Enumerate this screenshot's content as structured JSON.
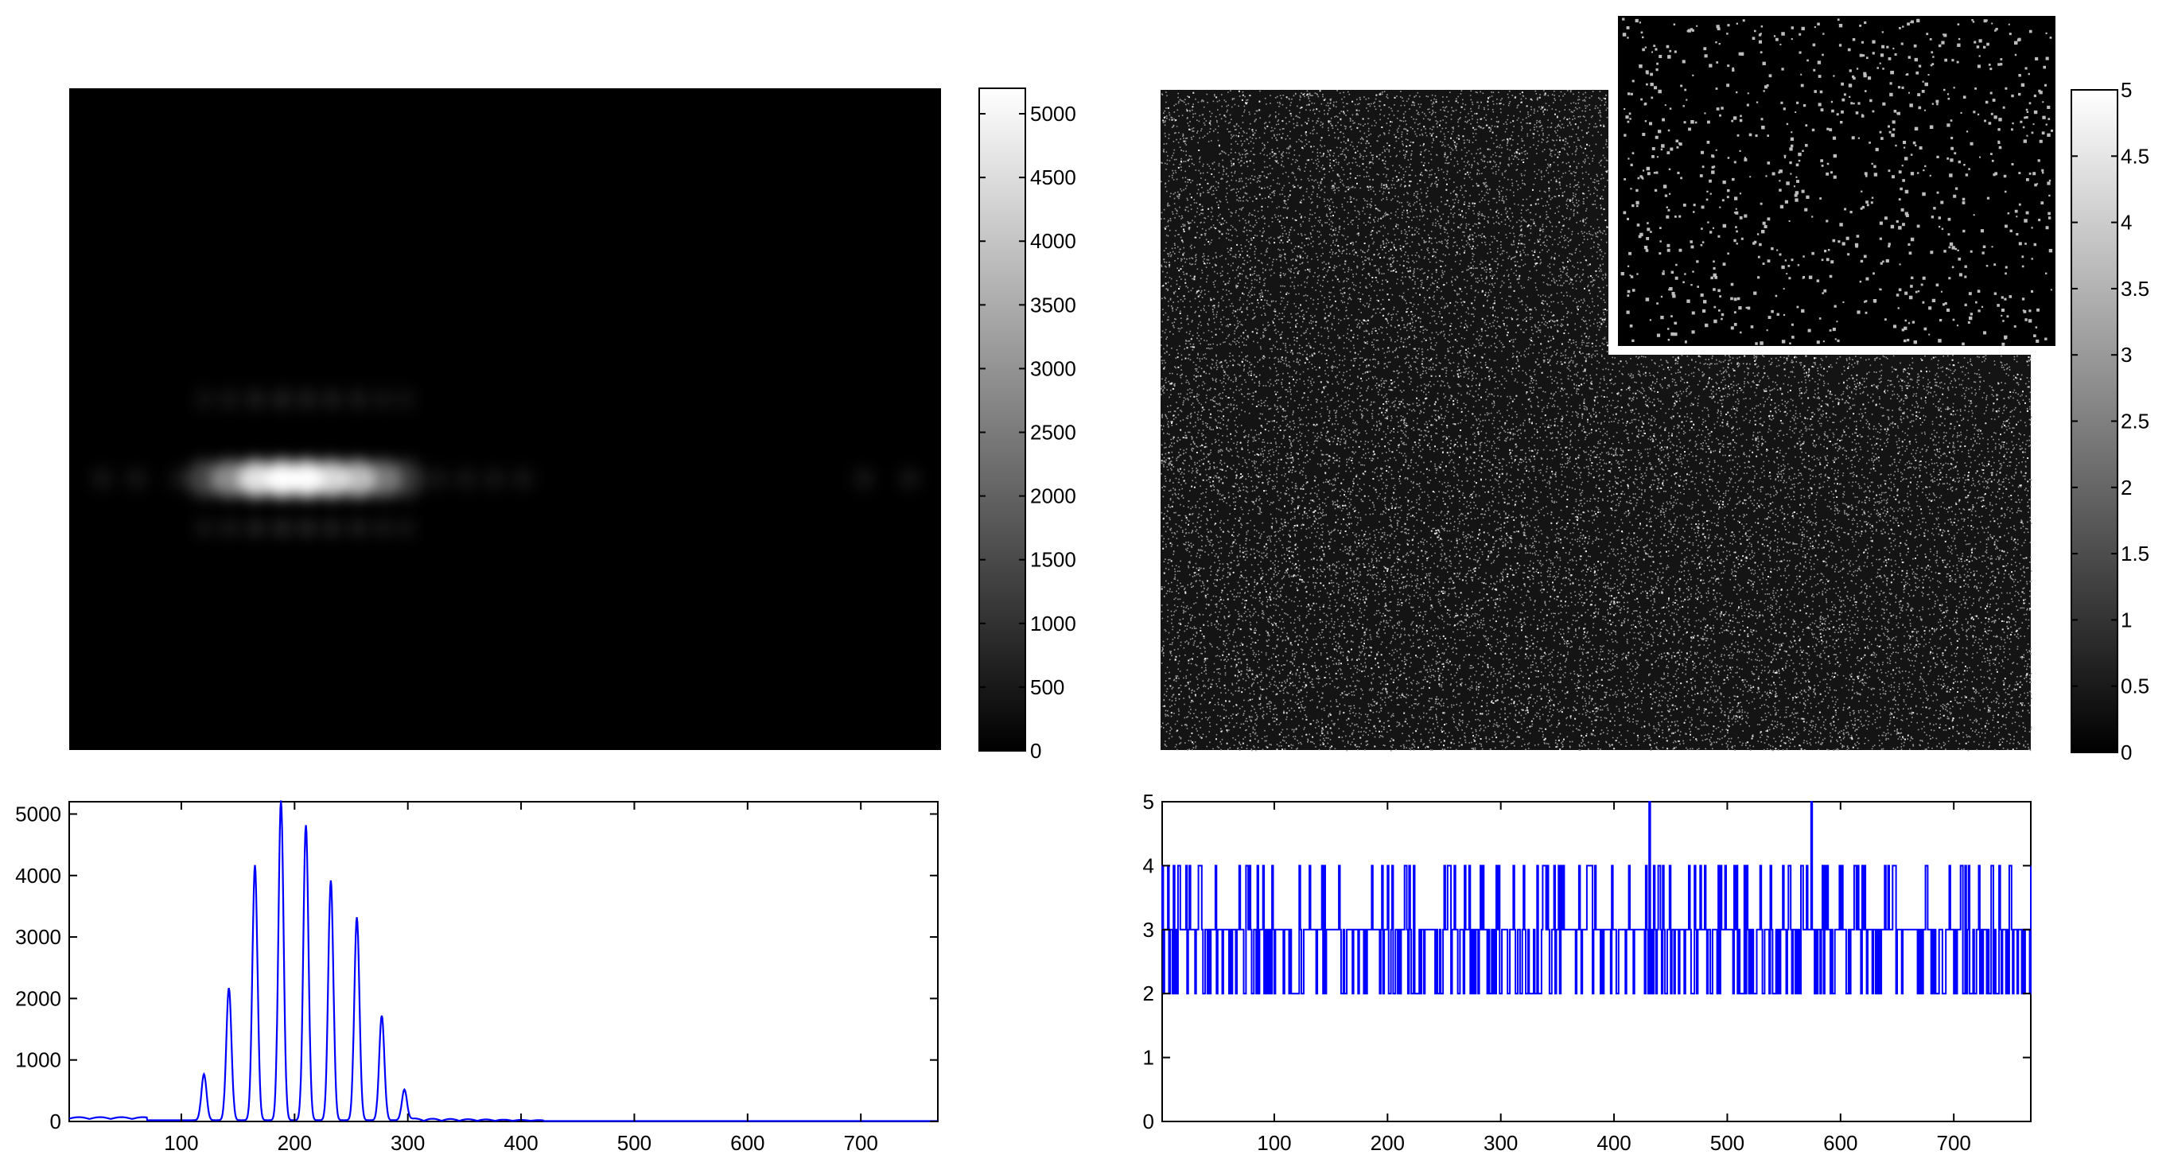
{
  "colors": {
    "line": "#0000ff",
    "image_background": "#000000",
    "axis": "#000000",
    "frame": "#ffffff"
  },
  "chart_data": [
    {
      "type": "heatmap",
      "colormap": "gray",
      "clim": [
        0,
        5200
      ],
      "colorbar_ticks": [
        "0",
        "500",
        "1000",
        "1500",
        "2000",
        "2500",
        "3000",
        "3500",
        "4000",
        "4500",
        "5000"
      ],
      "colorbar_tick_values": [
        0,
        500,
        1000,
        1500,
        2000,
        2500,
        3000,
        3500,
        4000,
        4500,
        5000
      ],
      "columns": 768,
      "spot_centers_x": [
        120,
        142,
        165,
        188,
        210,
        232,
        255,
        277,
        297
      ],
      "spot_peaks": [
        750,
        2150,
        4150,
        5200,
        4800,
        3900,
        3300,
        1700,
        500
      ],
      "center_row_fraction": 0.59
    },
    {
      "type": "line",
      "xlim": [
        1,
        768
      ],
      "ylim": [
        0,
        5200
      ],
      "xticks": [
        "100",
        "200",
        "300",
        "400",
        "500",
        "600",
        "700"
      ],
      "xtick_values": [
        100,
        200,
        300,
        400,
        500,
        600,
        700
      ],
      "yticks": [
        "0",
        "1000",
        "2000",
        "3000",
        "4000",
        "5000"
      ],
      "ytick_values": [
        0,
        1000,
        2000,
        3000,
        4000,
        5000
      ],
      "grid": false,
      "peaks": [
        {
          "x": 120,
          "y": 750
        },
        {
          "x": 142,
          "y": 2150
        },
        {
          "x": 165,
          "y": 4150
        },
        {
          "x": 188,
          "y": 5200
        },
        {
          "x": 210,
          "y": 4800
        },
        {
          "x": 232,
          "y": 3900
        },
        {
          "x": 255,
          "y": 3300
        },
        {
          "x": 277,
          "y": 1700
        },
        {
          "x": 297,
          "y": 500
        }
      ],
      "baseline": 40
    },
    {
      "type": "heatmap",
      "colormap": "gray",
      "clim": [
        0,
        5
      ],
      "colorbar_ticks": [
        "0",
        "0.5",
        "1",
        "1.5",
        "2",
        "2.5",
        "3",
        "3.5",
        "4",
        "4.5",
        "5"
      ],
      "colorbar_tick_values": [
        0,
        0.5,
        1,
        1.5,
        2,
        2.5,
        3,
        3.5,
        4,
        4.5,
        5
      ],
      "content": "sparse random speckle",
      "inset": "zoomed region of the speckle pattern, shown at top-right"
    },
    {
      "type": "line",
      "xlim": [
        1,
        768
      ],
      "ylim": [
        0,
        5
      ],
      "xticks": [
        "100",
        "200",
        "300",
        "400",
        "500",
        "600",
        "700"
      ],
      "xtick_values": [
        100,
        200,
        300,
        400,
        500,
        600,
        700
      ],
      "yticks": [
        "0",
        "1",
        "2",
        "3",
        "4",
        "5"
      ],
      "ytick_values": [
        0,
        1,
        2,
        3,
        4,
        5
      ],
      "grid": false,
      "levels": [
        2,
        3,
        4,
        5
      ],
      "base_level": 3,
      "max_spikes_x": [
        431,
        574
      ]
    }
  ]
}
